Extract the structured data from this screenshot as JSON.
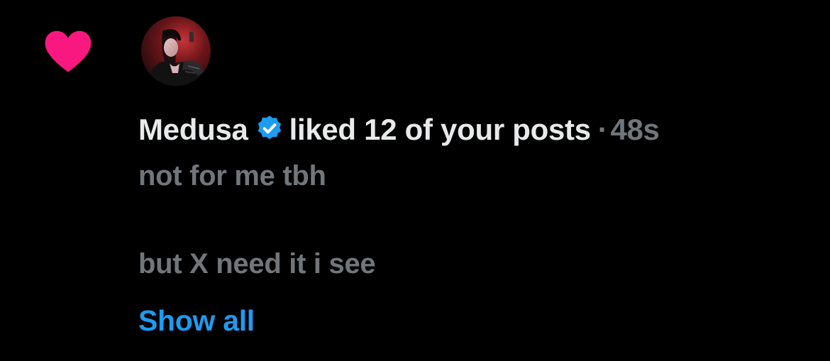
{
  "notification": {
    "type_icon": "heart-icon",
    "avatar_icon": "profile-photo",
    "user_name": "Medusa",
    "verified_icon": "verified-badge-icon",
    "action_text": "liked 12 of your posts",
    "separator": "·",
    "timestamp": "48s",
    "post_snippet": {
      "line1": "not for me tbh",
      "line2": "but X need it i see"
    },
    "show_all_label": "Show all"
  },
  "colors": {
    "background": "#000000",
    "heart": "#f91880",
    "primary_text": "#e7e9ea",
    "secondary_text": "#71767b",
    "link": "#1d9bf0",
    "verified": "#1d9bf0"
  }
}
